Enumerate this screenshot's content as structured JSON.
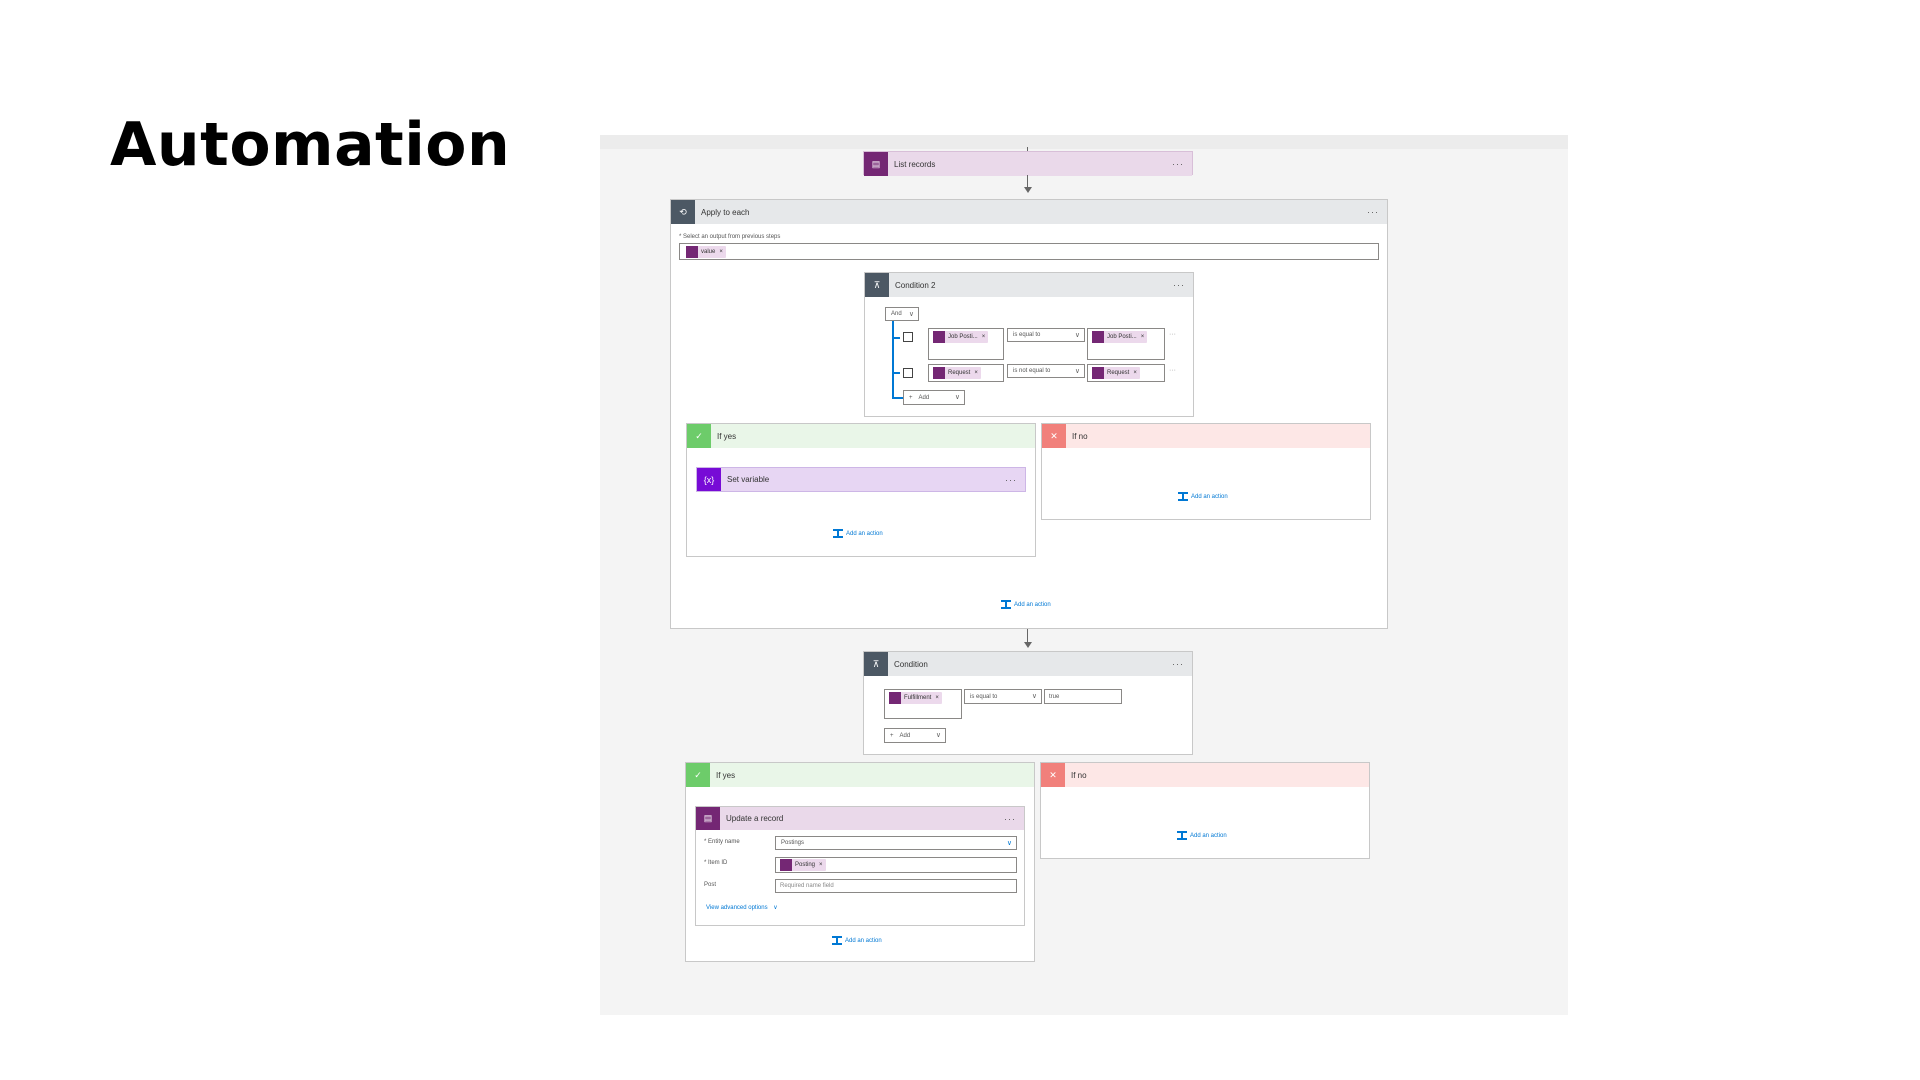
{
  "slide": {
    "title": "Automation"
  },
  "flow": {
    "list_records": {
      "title": "List records",
      "more": "···"
    },
    "apply_each": {
      "title": "Apply to each",
      "more": "···",
      "select_label": "* Select an output from previous steps",
      "token": "value",
      "condition2": {
        "title": "Condition 2",
        "more": "···",
        "group_op": "And",
        "rows": [
          {
            "left": "Job Posti...",
            "op": "is equal to",
            "right": "Job Posti..."
          },
          {
            "left": "Request",
            "op": "is not equal to",
            "right": "Request"
          }
        ],
        "add_label": "Add"
      },
      "if_yes": {
        "title": "If yes",
        "set_variable": "Set variable",
        "more": "···",
        "add_action": "Add an action"
      },
      "if_no": {
        "title": "If no",
        "add_action": "Add an action"
      },
      "add_action": "Add an action"
    },
    "condition": {
      "title": "Condition",
      "more": "···",
      "row": {
        "left": "Fulfillment",
        "op": "is equal to",
        "right": "true"
      },
      "add_label": "Add"
    },
    "if_yes2": {
      "title": "If yes",
      "update": {
        "title": "Update a record",
        "more": "···",
        "entity_label": "* Entity name",
        "entity_value": "Postings",
        "item_label": "* Item ID",
        "item_token": "Posting",
        "post_label": "Post",
        "post_placeholder": "Required name field",
        "advanced": "View advanced options"
      },
      "add_action": "Add an action"
    },
    "if_no2": {
      "title": "If no",
      "add_action": "Add an action"
    }
  },
  "icons": {
    "x": "×",
    "chevron": "∨",
    "check": "✓",
    "cross": "✕",
    "variable": "{x}",
    "plus": "+"
  },
  "colors": {
    "dataverse": "#742774",
    "control": "#4c5864",
    "yes": "#6dcc6a",
    "no": "#f1807b",
    "variable": "#770bd6",
    "link": "#0078d4"
  }
}
